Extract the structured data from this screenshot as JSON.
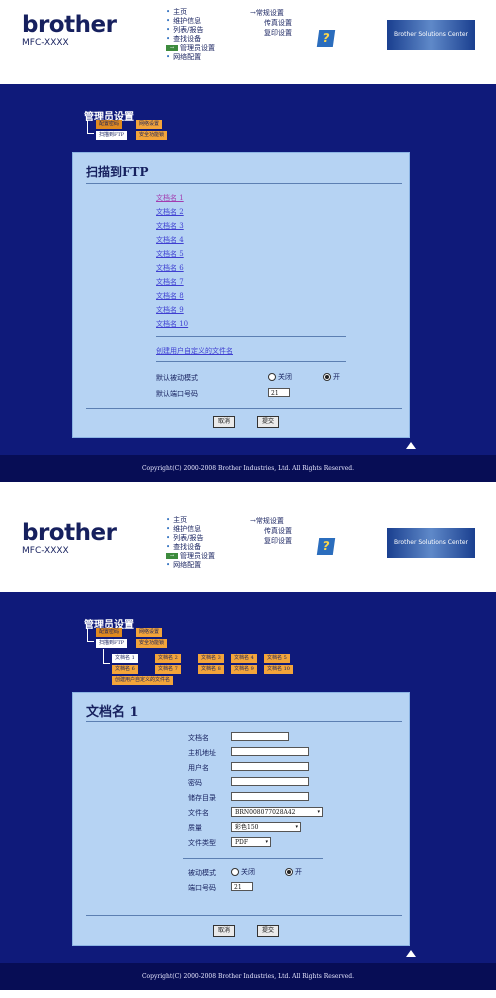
{
  "brand": {
    "logo": "brother",
    "model": "MFC-XXXX",
    "solutions_center": "Brother Solutions Center",
    "help_icon": "?"
  },
  "nav": {
    "left": [
      "主页",
      "维护信息",
      "列表/报告",
      "查找设备",
      "管理员设置",
      "网络配置"
    ],
    "right": [
      "常规设置",
      "传真设置",
      "复印设置"
    ]
  },
  "screen1": {
    "section_title": "管理员设置",
    "tabs": [
      "配置密码",
      "网络设置",
      "扫描到FTP",
      "安全功能锁"
    ],
    "content_title": "扫描到FTP",
    "file_links": [
      "文档名 1",
      "文档名 2",
      "文档名 3",
      "文档名 4",
      "文档名 5",
      "文档名 6",
      "文档名 7",
      "文档名 8",
      "文档名 9",
      "文档名 10"
    ],
    "custom_link": "创建用户自定义的文件名",
    "passive_mode_label": "默认被动模式",
    "passive_off": "关闭",
    "passive_on": "开",
    "port_label": "默认端口号码",
    "port_value": "21",
    "cancel": "取消",
    "submit": "提交",
    "footer": "Copyright(C) 2000-2008 Brother Industries, Ltd. All Rights Reserved."
  },
  "screen2": {
    "section_title": "管理员设置",
    "tabs": [
      "配置密码",
      "网络设置",
      "扫描到FTP",
      "安全功能锁"
    ],
    "doc_tabs": [
      "文档名 1",
      "文档名 2",
      "文档名 3",
      "文档名 4",
      "文档名 5",
      "文档名 6",
      "文档名 7",
      "文档名 8",
      "文档名 9",
      "文档名 10"
    ],
    "custom_tab": "创建用户自定义的文件名",
    "content_title": "文档名 1",
    "fields": {
      "profile_name": "文档名",
      "host": "主机地址",
      "username": "用户名",
      "password": "密码",
      "store_dir": "储存目录",
      "file_name": "文件名",
      "quality": "质量",
      "file_type": "文件类型",
      "passive_mode": "被动模式",
      "port": "端口号码"
    },
    "file_name_value": "BRN008077028A42",
    "quality_value": "彩色150",
    "file_type_value": "PDF",
    "passive_off": "关闭",
    "passive_on": "开",
    "port_value": "21",
    "cancel": "取消",
    "submit": "提交",
    "footer": "Copyright(C) 2000-2008 Brother Industries, Ltd. All Rights Reserved."
  }
}
